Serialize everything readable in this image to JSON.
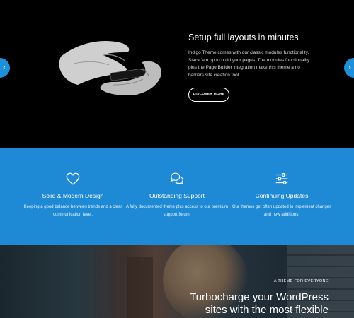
{
  "hero": {
    "title": "Setup full layouts in minutes",
    "description": "Indigo Theme comes with our classic modules functionality. Stack 'em up to build your pages. The modules functionality plus the Page Builder integration make this theme a no barriers site creation tool.",
    "button_label": "DISCOVER MORE",
    "prev_arrow": "‹",
    "next_arrow": "›"
  },
  "features": [
    {
      "icon": "heart-icon",
      "title": "Solid & Modern Design",
      "text": "Keeping a good balance between trends and a clear communication level."
    },
    {
      "icon": "chat-bubbles-icon",
      "title": "Outstanding Support",
      "text": "A fully documented theme plus access to our premium support forum."
    },
    {
      "icon": "sliders-icon",
      "title": "Continuing Updates",
      "text": "Our themes get often updated to implement changes and new additions."
    }
  ],
  "bottom": {
    "eyebrow": "A THEME FOR EVERYONE",
    "title": "Turbocharge your WordPress sites with the most flexible"
  },
  "colors": {
    "accent": "#1e8ad6",
    "hero_bg": "#000000"
  }
}
